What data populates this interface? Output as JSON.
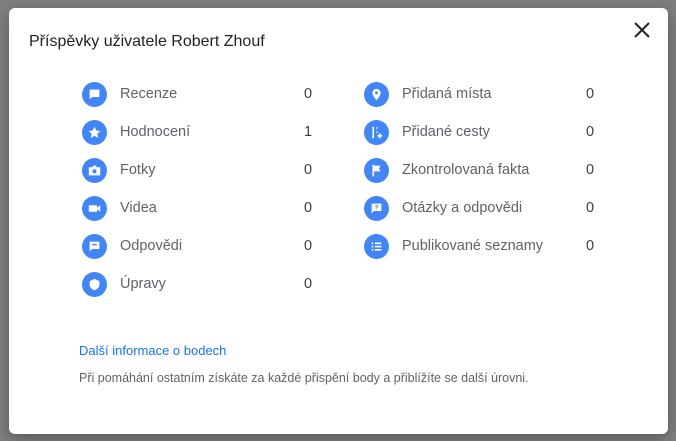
{
  "dialog": {
    "title": "Příspěvky uživatele Robert Zhouf",
    "more_link": "Další informace o bodech",
    "note": "Při pomáhání ostatním získáte za každé přispění body a přiblížíte se další úrovni."
  },
  "left_items": [
    {
      "icon": "review-icon",
      "label": "Recenze",
      "value": "0"
    },
    {
      "icon": "star-icon",
      "label": "Hodnocení",
      "value": "1"
    },
    {
      "icon": "camera-icon",
      "label": "Fotky",
      "value": "0"
    },
    {
      "icon": "video-icon",
      "label": "Videa",
      "value": "0"
    },
    {
      "icon": "answer-icon",
      "label": "Odpovědi",
      "value": "0"
    },
    {
      "icon": "edit-shield-icon",
      "label": "Úpravy",
      "value": "0"
    }
  ],
  "right_items": [
    {
      "icon": "place-pin-icon",
      "label": "Přidaná místa",
      "value": "0"
    },
    {
      "icon": "road-add-icon",
      "label": "Přidané cesty",
      "value": "0"
    },
    {
      "icon": "flag-icon",
      "label": "Zkontrolovaná fakta",
      "value": "0"
    },
    {
      "icon": "question-icon",
      "label": "Otázky a odpovědi",
      "value": "0"
    },
    {
      "icon": "list-icon",
      "label": "Publikované seznamy",
      "value": "0"
    }
  ],
  "colors": {
    "accent": "#4285f4",
    "link": "#1a73e8"
  }
}
